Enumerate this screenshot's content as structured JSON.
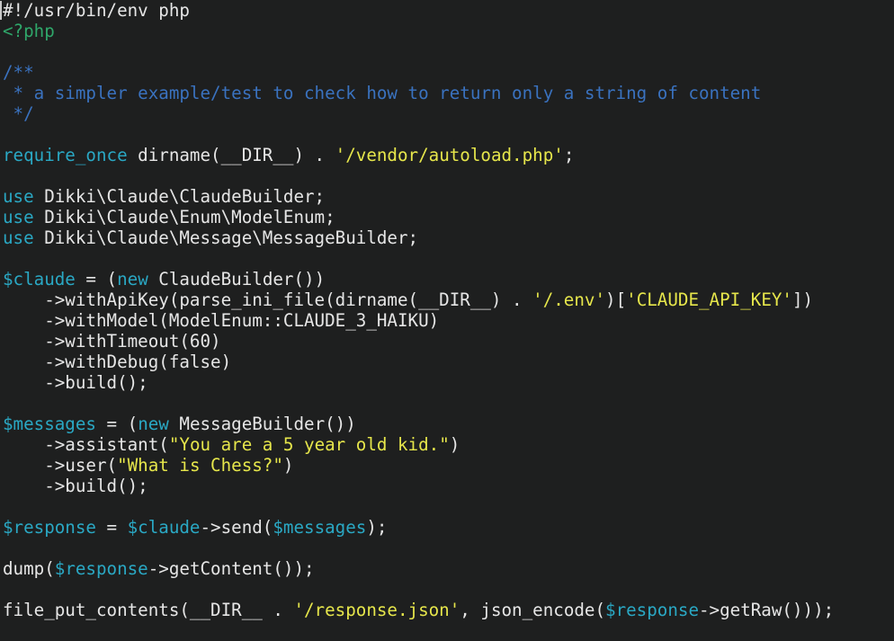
{
  "editor": {
    "language": "PHP",
    "background_color": "#1e1f1f",
    "caret_visible": true,
    "font_size_px": 19,
    "line_height_px": 23,
    "colors": {
      "plain": "#e6e6e6",
      "comment": "#3a72bf",
      "php_tag": "#2fa76a",
      "keyword": "#2aa8c4",
      "variable": "#2aa8c4",
      "string": "#e6e64b"
    }
  },
  "lines": [
    {
      "n": 1,
      "text": "#!/usr/bin/env php"
    },
    {
      "n": 2,
      "text": "<?php"
    },
    {
      "n": 3,
      "text": ""
    },
    {
      "n": 4,
      "text": "/**"
    },
    {
      "n": 5,
      "text": " * a simpler example/test to check how to return only a string of content"
    },
    {
      "n": 6,
      "text": " */"
    },
    {
      "n": 7,
      "text": ""
    },
    {
      "n": 8,
      "text": "require_once dirname(__DIR__) . '/vendor/autoload.php';"
    },
    {
      "n": 9,
      "text": ""
    },
    {
      "n": 10,
      "text": "use Dikki\\Claude\\ClaudeBuilder;"
    },
    {
      "n": 11,
      "text": "use Dikki\\Claude\\Enum\\ModelEnum;"
    },
    {
      "n": 12,
      "text": "use Dikki\\Claude\\Message\\MessageBuilder;"
    },
    {
      "n": 13,
      "text": ""
    },
    {
      "n": 14,
      "text": "$claude = (new ClaudeBuilder())"
    },
    {
      "n": 15,
      "text": "    ->withApiKey(parse_ini_file(dirname(__DIR__) . '/.env')['CLAUDE_API_KEY'])"
    },
    {
      "n": 16,
      "text": "    ->withModel(ModelEnum::CLAUDE_3_HAIKU)"
    },
    {
      "n": 17,
      "text": "    ->withTimeout(60)"
    },
    {
      "n": 18,
      "text": "    ->withDebug(false)"
    },
    {
      "n": 19,
      "text": "    ->build();"
    },
    {
      "n": 20,
      "text": ""
    },
    {
      "n": 21,
      "text": "$messages = (new MessageBuilder())"
    },
    {
      "n": 22,
      "text": "    ->assistant(\"You are a 5 year old kid.\")"
    },
    {
      "n": 23,
      "text": "    ->user(\"What is Chess?\")"
    },
    {
      "n": 24,
      "text": "    ->build();"
    },
    {
      "n": 25,
      "text": ""
    },
    {
      "n": 26,
      "text": "$response = $claude->send($messages);"
    },
    {
      "n": 27,
      "text": ""
    },
    {
      "n": 28,
      "text": "dump($response->getContent());"
    },
    {
      "n": 29,
      "text": ""
    },
    {
      "n": 30,
      "text": "file_put_contents(__DIR__ . '/response.json', json_encode($response->getRaw()));"
    }
  ],
  "tokens": {
    "l1": [
      {
        "t": "#!/usr/bin/env php",
        "c": "plain"
      }
    ],
    "l2": [
      {
        "t": "<?php",
        "c": "tag"
      }
    ],
    "l4": [
      {
        "t": "/**",
        "c": "comment"
      }
    ],
    "l5": [
      {
        "t": " * a simpler example/test to check how to return only a string of content",
        "c": "comment"
      }
    ],
    "l6": [
      {
        "t": " */",
        "c": "comment"
      }
    ],
    "l8": [
      {
        "t": "require_once",
        "c": "keyword"
      },
      {
        "t": " dirname(__DIR__) . ",
        "c": "plain"
      },
      {
        "t": "'/vendor/autoload.php'",
        "c": "string"
      },
      {
        "t": ";",
        "c": "plain"
      }
    ],
    "l10": [
      {
        "t": "use",
        "c": "keyword"
      },
      {
        "t": " Dikki\\Claude\\ClaudeBuilder;",
        "c": "plain"
      }
    ],
    "l11": [
      {
        "t": "use",
        "c": "keyword"
      },
      {
        "t": " Dikki\\Claude\\Enum\\ModelEnum;",
        "c": "plain"
      }
    ],
    "l12": [
      {
        "t": "use",
        "c": "keyword"
      },
      {
        "t": " Dikki\\Claude\\Message\\MessageBuilder;",
        "c": "plain"
      }
    ],
    "l14": [
      {
        "t": "$claude",
        "c": "var"
      },
      {
        "t": " = (",
        "c": "plain"
      },
      {
        "t": "new",
        "c": "keyword"
      },
      {
        "t": " ClaudeBuilder())",
        "c": "plain"
      }
    ],
    "l15": [
      {
        "t": "    ->withApiKey(parse_ini_file(dirname(__DIR__) . ",
        "c": "plain"
      },
      {
        "t": "'/.env'",
        "c": "string"
      },
      {
        "t": ")[",
        "c": "plain"
      },
      {
        "t": "'CLAUDE_API_KEY'",
        "c": "string"
      },
      {
        "t": "])",
        "c": "plain"
      }
    ],
    "l16": [
      {
        "t": "    ->withModel(ModelEnum::CLAUDE_3_HAIKU)",
        "c": "plain"
      }
    ],
    "l17": [
      {
        "t": "    ->withTimeout(60)",
        "c": "plain"
      }
    ],
    "l18": [
      {
        "t": "    ->withDebug(false)",
        "c": "plain"
      }
    ],
    "l19": [
      {
        "t": "    ->build();",
        "c": "plain"
      }
    ],
    "l21": [
      {
        "t": "$messages",
        "c": "var"
      },
      {
        "t": " = (",
        "c": "plain"
      },
      {
        "t": "new",
        "c": "keyword"
      },
      {
        "t": " MessageBuilder())",
        "c": "plain"
      }
    ],
    "l22": [
      {
        "t": "    ->assistant(",
        "c": "plain"
      },
      {
        "t": "\"You are a 5 year old kid.\"",
        "c": "string"
      },
      {
        "t": ")",
        "c": "plain"
      }
    ],
    "l23": [
      {
        "t": "    ->user(",
        "c": "plain"
      },
      {
        "t": "\"What is Chess?\"",
        "c": "string"
      },
      {
        "t": ")",
        "c": "plain"
      }
    ],
    "l24": [
      {
        "t": "    ->build();",
        "c": "plain"
      }
    ],
    "l26": [
      {
        "t": "$response",
        "c": "var"
      },
      {
        "t": " = ",
        "c": "plain"
      },
      {
        "t": "$claude",
        "c": "var"
      },
      {
        "t": "->send(",
        "c": "plain"
      },
      {
        "t": "$messages",
        "c": "var"
      },
      {
        "t": ");",
        "c": "plain"
      }
    ],
    "l28": [
      {
        "t": "dump(",
        "c": "plain"
      },
      {
        "t": "$response",
        "c": "var"
      },
      {
        "t": "->getContent());",
        "c": "plain"
      }
    ],
    "l30": [
      {
        "t": "file_put_contents(__DIR__ . ",
        "c": "plain"
      },
      {
        "t": "'/response.json'",
        "c": "string"
      },
      {
        "t": ", json_encode(",
        "c": "plain"
      },
      {
        "t": "$response",
        "c": "var"
      },
      {
        "t": "->getRaw()));",
        "c": "plain"
      }
    ]
  }
}
